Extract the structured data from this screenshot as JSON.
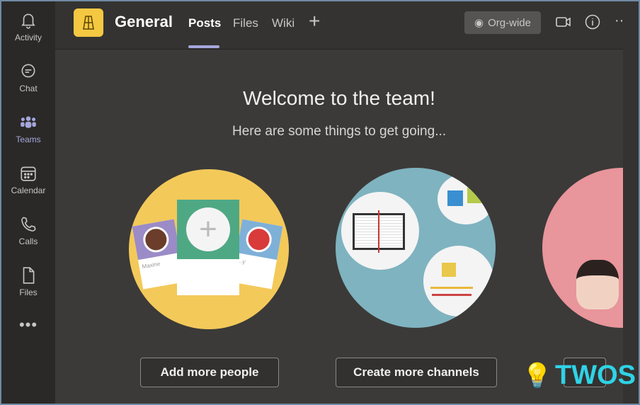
{
  "rail": {
    "items": [
      {
        "label": "Activity",
        "icon": "bell-icon"
      },
      {
        "label": "Chat",
        "icon": "chat-icon"
      },
      {
        "label": "Teams",
        "icon": "teams-icon",
        "active": true
      },
      {
        "label": "Calendar",
        "icon": "calendar-icon"
      },
      {
        "label": "Calls",
        "icon": "phone-icon"
      },
      {
        "label": "Files",
        "icon": "file-icon"
      }
    ],
    "more": "•••"
  },
  "header": {
    "channel": "General",
    "tabs": [
      "Posts",
      "Files",
      "Wiki"
    ],
    "active_tab": "Posts",
    "add_tab": "+",
    "org_wide": "Org-wide",
    "more": "···"
  },
  "main": {
    "title": "Welcome to the team!",
    "subtitle": "Here are some things to get going...",
    "cards": [
      {
        "name": "Maxine"
      },
      {
        "name": "...y"
      }
    ],
    "buttons": [
      "Add more people",
      "Create more channels"
    ]
  },
  "watermark": "TWOS",
  "colors": {
    "accent": "#a6a7dc",
    "yellow": "#f5c842",
    "teal": "#7fb3c0",
    "pink": "#e8959b"
  }
}
